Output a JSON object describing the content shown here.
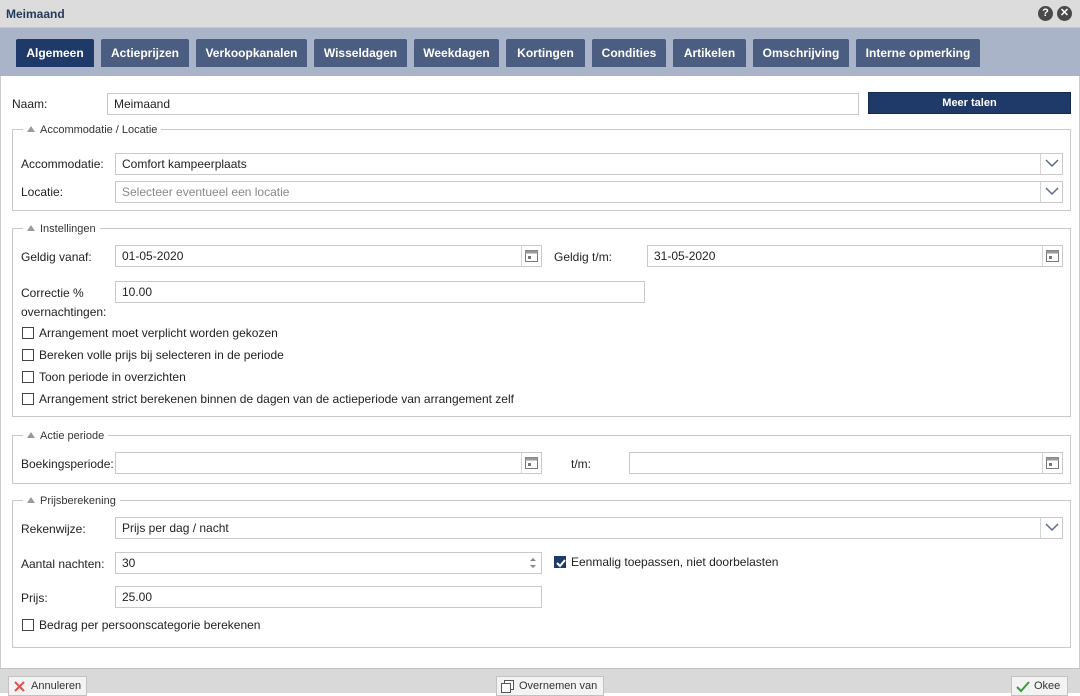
{
  "window": {
    "title": "Meimaand"
  },
  "tabs": [
    {
      "label": "Algemeen",
      "active": true
    },
    {
      "label": "Actieprijzen"
    },
    {
      "label": "Verkoopkanalen"
    },
    {
      "label": "Wisseldagen"
    },
    {
      "label": "Weekdagen"
    },
    {
      "label": "Kortingen"
    },
    {
      "label": "Condities"
    },
    {
      "label": "Artikelen"
    },
    {
      "label": "Omschrijving"
    },
    {
      "label": "Interne opmerking"
    }
  ],
  "general": {
    "name_label": "Naam:",
    "name_value": "Meimaand",
    "more_languages_label": "Meer talen"
  },
  "accommodation_section": {
    "legend": "Accommodatie / Locatie",
    "accommodation_label": "Accommodatie:",
    "accommodation_value": "Comfort kampeerplaats",
    "location_label": "Locatie:",
    "location_placeholder": "Selecteer eventueel een locatie"
  },
  "settings_section": {
    "legend": "Instellingen",
    "valid_from_label": "Geldig vanaf:",
    "valid_from_value": "01-05-2020",
    "valid_until_label": "Geldig t/m:",
    "valid_until_value": "31-05-2020",
    "correction_label_line1": "Correctie %",
    "correction_label_line2": "overnachtingen:",
    "correction_value": "10.00",
    "checkboxes": [
      {
        "label": "Arrangement moet verplicht worden gekozen",
        "checked": false
      },
      {
        "label": "Bereken volle prijs bij selecteren in de periode",
        "checked": false
      },
      {
        "label": "Toon periode in overzichten",
        "checked": false
      },
      {
        "label": "Arrangement strict berekenen binnen de dagen van de actieperiode van arrangement zelf",
        "checked": false
      }
    ]
  },
  "action_period_section": {
    "legend": "Actie periode",
    "booking_period_label": "Boekingsperiode:",
    "booking_period_value": "",
    "until_label": "t/m:",
    "until_value": ""
  },
  "pricing_section": {
    "legend": "Prijsberekening",
    "method_label": "Rekenwijze:",
    "method_value": "Prijs per dag / nacht",
    "nights_label": "Aantal nachten:",
    "nights_value": "30",
    "apply_once_label": "Eenmalig toepassen, niet doorbelasten",
    "apply_once_checked": true,
    "price_label": "Prijs:",
    "price_value": "25.00",
    "per_person_label": "Bedrag per persoonscategorie berekenen",
    "per_person_checked": false
  },
  "footer": {
    "cancel_label": "Annuleren",
    "copy_from_label": "Overnemen van",
    "ok_label": "Okee"
  },
  "colors": {
    "tab_active": "#1f3a68",
    "tab_inactive": "#4b5d81",
    "tabbar_bg": "#a9b4c8",
    "primary_button": "#1f3a68",
    "cancel_icon": "#d9534f",
    "ok_icon": "#3a9a3a"
  }
}
